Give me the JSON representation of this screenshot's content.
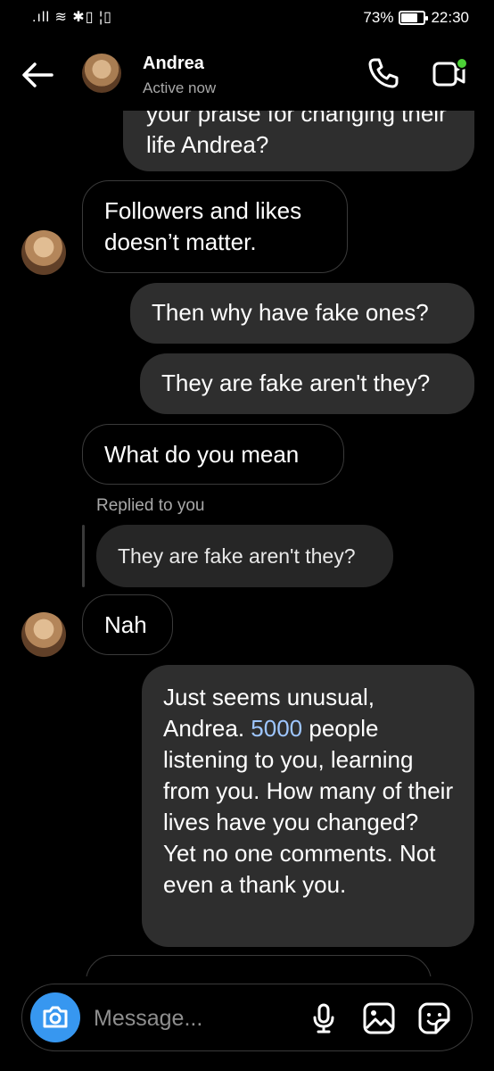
{
  "status_bar": {
    "left_icons": ".ıll ≋ ✱▯ ¦▯",
    "battery_percent": "73%",
    "battery_level": 0.73,
    "time": "22:30"
  },
  "header": {
    "contact_name": "Andrea",
    "contact_status": "Active now",
    "online_color": "#4cd137"
  },
  "messages": [
    {
      "direction": "out",
      "text": "your praise for changing their life Andrea?"
    },
    {
      "direction": "in",
      "text": "Followers and likes doesn’t matter."
    },
    {
      "direction": "out",
      "text": "Then why have fake ones?"
    },
    {
      "direction": "out",
      "text": "They are fake aren't they?"
    },
    {
      "direction": "in",
      "text": "What do you mean"
    },
    {
      "direction": "in",
      "reply_label": "Replied to you",
      "quoted_text": "They are fake aren't they?"
    },
    {
      "direction": "in",
      "text": "Nah"
    },
    {
      "direction": "out",
      "text_before": "Just seems unusual, Andrea. ",
      "highlight": "5000",
      "text_after": " people listening to you, learning from you. How many of their lives have you changed? Yet no one comments. Not even a thank you."
    }
  ],
  "composer": {
    "placeholder": "Message...",
    "icons": [
      "camera-icon",
      "microphone-icon",
      "image-icon",
      "sticker-icon"
    ]
  },
  "colors": {
    "background": "#000000",
    "outgoing_bubble": "#2e2e2e",
    "incoming_border": "#3a3a3a",
    "accent_blue": "#3797f0",
    "link_blue": "#9ec6ff"
  }
}
